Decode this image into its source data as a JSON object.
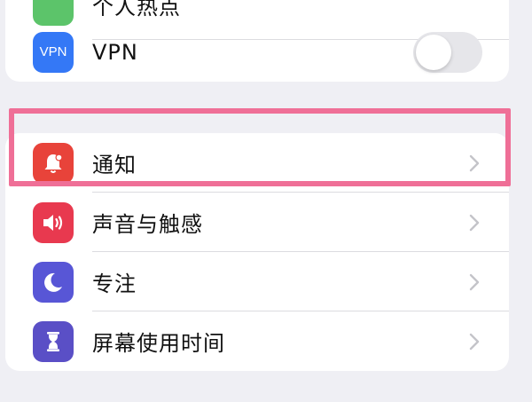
{
  "top_group": {
    "partial_item_label": "个人热点",
    "vpn": {
      "icon_text": "VPN",
      "label": "VPN",
      "toggle_state": "off"
    }
  },
  "main_group": {
    "items": [
      {
        "label": "通知",
        "icon": "notification-bell-icon",
        "icon_color": "#e8433a"
      },
      {
        "label": "声音与触感",
        "icon": "speaker-icon",
        "icon_color": "#e8394f"
      },
      {
        "label": "专注",
        "icon": "moon-icon",
        "icon_color": "#5856d6"
      },
      {
        "label": "屏幕使用时间",
        "icon": "hourglass-icon",
        "icon_color": "#5a4fc6"
      }
    ]
  },
  "highlight": {
    "color": "#ef6f97",
    "target": "通知"
  },
  "colors": {
    "background": "#efeff4",
    "vpn_icon": "#3478f6",
    "chevron": "#c4c4c9"
  }
}
